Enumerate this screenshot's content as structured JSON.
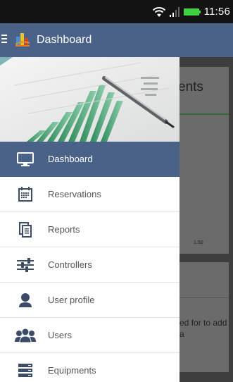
{
  "status_bar": {
    "time": "11:56"
  },
  "action_bar": {
    "title": "Dashboard"
  },
  "background": {
    "card_title": "ents",
    "tick_label": "1.50",
    "message": "ed for to add a"
  },
  "drawer": {
    "items": [
      {
        "label": "Dashboard",
        "icon": "monitor-icon",
        "active": true
      },
      {
        "label": "Reservations",
        "icon": "calendar-icon",
        "active": false
      },
      {
        "label": "Reports",
        "icon": "documents-icon",
        "active": false
      },
      {
        "label": "Controllers",
        "icon": "sliders-icon",
        "active": false
      },
      {
        "label": "User profile",
        "icon": "user-icon",
        "active": false
      },
      {
        "label": "Users",
        "icon": "users-icon",
        "active": false
      },
      {
        "label": "Equipments",
        "icon": "server-icon",
        "active": false
      }
    ]
  },
  "colors": {
    "primary": "#4a6288",
    "status_bar": "#131313",
    "battery": "#3fd13f"
  }
}
